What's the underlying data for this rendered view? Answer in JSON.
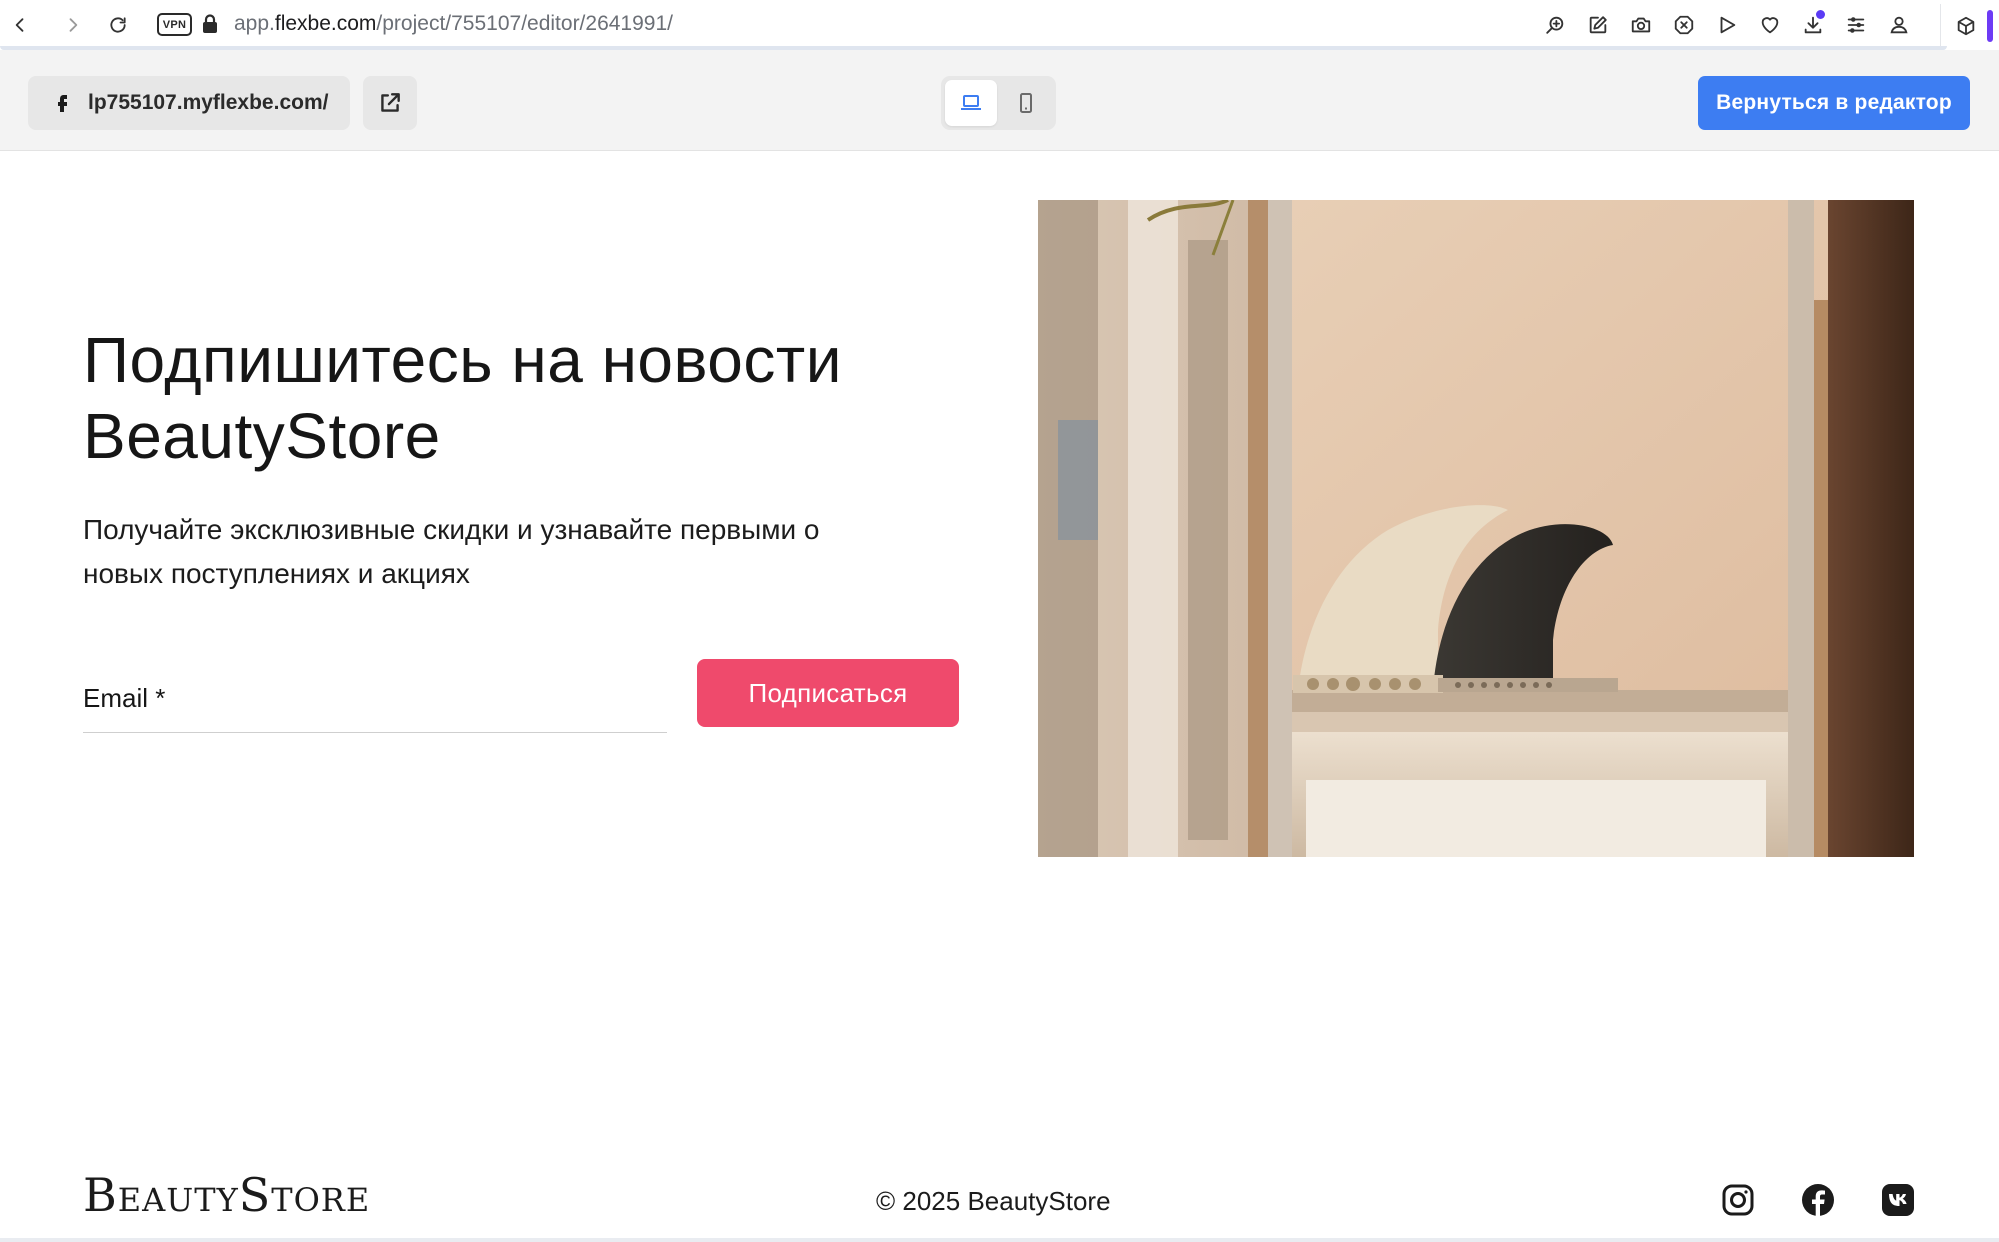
{
  "browser": {
    "vpn_label": "VPN",
    "url_prefix": "app.",
    "url_domain": "flexbe.com",
    "url_path": "/project/755107/editor/2641991/",
    "toolbar_icons": [
      "zoom-in-icon",
      "edit-icon",
      "camera-icon",
      "close-circle-icon",
      "play-icon",
      "heart-icon",
      "download-icon",
      "settings-sliders-icon",
      "profile-icon"
    ],
    "accent": "#6d3bf5"
  },
  "preview_bar": {
    "site_url": "lp755107.myflexbe.com/",
    "back_to_editor_label": "Вернуться в редактор",
    "active_device": "desktop",
    "button_color": "#3d7df2"
  },
  "main": {
    "headline_line1": "Подпишитесь на новости",
    "headline_line2": "BeautyStore",
    "subtitle_line1": "Получайте эксклюзивные скидки и узнавайте первыми о",
    "subtitle_line2": "новых поступлениях и акциях",
    "email_label": "Email *",
    "subscribe_label": "Подписаться",
    "subscribe_color": "#ef4a6c"
  },
  "footer": {
    "logo": "BeautyStore",
    "copyright": "© 2025 BeautyStore",
    "socials": [
      "instagram-icon",
      "facebook-icon",
      "vk-icon"
    ]
  }
}
